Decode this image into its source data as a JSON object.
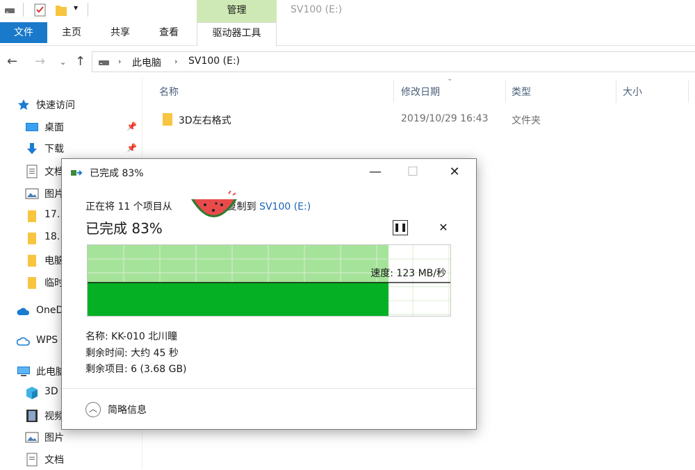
{
  "window": {
    "title": "SV100 (E:)",
    "contextual_tab_group": "管理"
  },
  "ribbon": {
    "tabs": [
      "文件",
      "主页",
      "共享",
      "查看",
      "驱动器工具"
    ]
  },
  "address_bar": {
    "breadcrumbs": [
      "此电脑",
      "SV100 (E:)"
    ]
  },
  "sidebar": {
    "quick_access_label": "快速访问",
    "items": [
      {
        "label": "桌面",
        "icon": "desktop-icon",
        "pinned": true
      },
      {
        "label": "下载",
        "icon": "download-icon",
        "pinned": true
      },
      {
        "label": "文档",
        "icon": "document-icon",
        "pinned": true
      },
      {
        "label": "图片",
        "icon": "picture-icon",
        "pinned": true
      },
      {
        "label": "17.",
        "icon": "folder-icon"
      },
      {
        "label": "18.",
        "icon": "folder-icon"
      },
      {
        "label": "电脑",
        "icon": "folder-icon"
      },
      {
        "label": "临时",
        "icon": "folder-icon"
      }
    ],
    "onedrive_label": "OneD",
    "wps_label": "WPS",
    "this_pc_label": "此电脑",
    "this_pc_items": [
      {
        "label": "3D",
        "icon": "3d-objects-icon"
      },
      {
        "label": "视频",
        "icon": "video-icon"
      },
      {
        "label": "图片",
        "icon": "picture-icon"
      },
      {
        "label": "文档",
        "icon": "document-icon"
      }
    ]
  },
  "file_list": {
    "columns": [
      "名称",
      "修改日期",
      "类型",
      "大小"
    ],
    "rows": [
      {
        "name": "3D左右格式",
        "modified": "2019/10/29 16:43",
        "type": "文件夹",
        "size": ""
      }
    ]
  },
  "copy_dialog": {
    "title": "已完成 83%",
    "copy_prefix": "正在将 11 个项目从",
    "copy_suffix": "复制到",
    "destination": "SV100 (E:)",
    "percent_text": "已完成 83%",
    "progress": 0.83,
    "speed": "速度: 123 MB/秒",
    "name_line": "名称: KK-010 北川瞳",
    "time_left": "剩余时间: 大约 45 秒",
    "items_left": "剩余项目: 6 (3.68 GB)",
    "details_toggle": "简略信息",
    "colors": {
      "progress_fill": "#06b025",
      "progress_light": "#a6e39a",
      "speed_line": "#000000"
    }
  }
}
